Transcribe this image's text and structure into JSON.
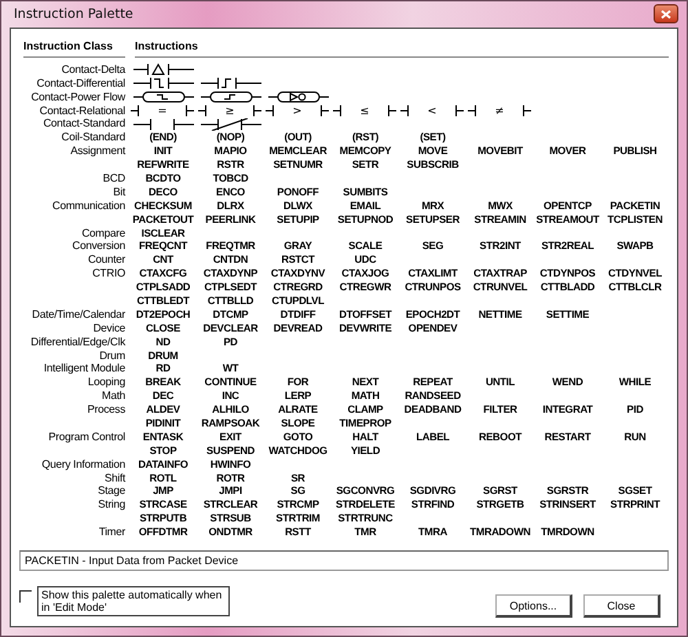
{
  "window": {
    "title": "Instruction Palette"
  },
  "headers": [
    "Instruction Class",
    "Instructions"
  ],
  "classes": [
    {
      "name": "Contact-Delta",
      "kind": "contact",
      "contacts": [
        {
          "kind": "delta"
        }
      ]
    },
    {
      "name": "Contact-Differential",
      "kind": "contact",
      "contacts": [
        {
          "kind": "falling"
        },
        {
          "kind": "rising"
        }
      ]
    },
    {
      "name": "Contact-Power Flow",
      "kind": "contact",
      "contacts": [
        {
          "kind": "pf-falling"
        },
        {
          "kind": "pf-rising"
        },
        {
          "kind": "pf-not"
        }
      ]
    },
    {
      "name": "Contact-Relational",
      "kind": "contact",
      "contacts": [
        {
          "kind": "relational",
          "symbol": "="
        },
        {
          "kind": "relational",
          "symbol": "≥"
        },
        {
          "kind": "relational",
          "symbol": ">"
        },
        {
          "kind": "relational",
          "symbol": "≤"
        },
        {
          "kind": "relational",
          "symbol": "<"
        },
        {
          "kind": "relational",
          "symbol": "≠"
        }
      ]
    },
    {
      "name": "Contact-Standard",
      "kind": "contact",
      "contacts": [
        {
          "kind": "open"
        },
        {
          "kind": "closed"
        }
      ]
    },
    {
      "name": "Coil-Standard",
      "kind": "text",
      "rows": [
        [
          "(END)",
          "(NOP)",
          "(OUT)",
          "(RST)",
          "(SET)"
        ]
      ]
    },
    {
      "name": "Assignment",
      "kind": "text",
      "rows": [
        [
          "INIT",
          "MAPIO",
          "MEMCLEAR",
          "MEMCOPY",
          "MOVE",
          "MOVEBIT",
          "MOVER",
          "PUBLISH"
        ],
        [
          "REFWRITE",
          "RSTR",
          "SETNUMR",
          "SETR",
          "SUBSCRIB"
        ]
      ]
    },
    {
      "name": "BCD",
      "kind": "text",
      "rows": [
        [
          "BCDTO",
          "TOBCD"
        ]
      ]
    },
    {
      "name": "Bit",
      "kind": "text",
      "rows": [
        [
          "DECO",
          "ENCO",
          "PONOFF",
          "SUMBITS"
        ]
      ]
    },
    {
      "name": "Communication",
      "kind": "text",
      "rows": [
        [
          "CHECKSUM",
          "DLRX",
          "DLWX",
          "EMAIL",
          "MRX",
          "MWX",
          "OPENTCP",
          "PACKETIN"
        ],
        [
          "PACKETOUT",
          "PEERLINK",
          "SETUPIP",
          "SETUPNOD",
          "SETUPSER",
          "STREAMIN",
          "STREAMOUT",
          "TCPLISTEN"
        ]
      ]
    },
    {
      "name": "Compare",
      "kind": "text",
      "rows": [
        [
          "ISCLEAR"
        ]
      ]
    },
    {
      "name": "Conversion",
      "kind": "text",
      "rows": [
        [
          "FREQCNT",
          "FREQTMR",
          "GRAY",
          "SCALE",
          "SEG",
          "STR2INT",
          "STR2REAL",
          "SWAPB"
        ]
      ]
    },
    {
      "name": "Counter",
      "kind": "text",
      "rows": [
        [
          "CNT",
          "CNTDN",
          "RSTCT",
          "UDC"
        ]
      ]
    },
    {
      "name": "CTRIO",
      "kind": "text",
      "rows": [
        [
          "CTAXCFG",
          "CTAXDYNP",
          "CTAXDYNV",
          "CTAXJOG",
          "CTAXLIMT",
          "CTAXTRAP",
          "CTDYNPOS",
          "CTDYNVEL"
        ],
        [
          "CTPLSADD",
          "CTPLSEDT",
          "CTREGRD",
          "CTREGWR",
          "CTRUNPOS",
          "CTRUNVEL",
          "CTTBLADD",
          "CTTBLCLR"
        ],
        [
          "CTTBLEDT",
          "CTTBLLD",
          "CTUPDLVL"
        ]
      ]
    },
    {
      "name": "Date/Time/Calendar",
      "kind": "text",
      "rows": [
        [
          "DT2EPOCH",
          "DTCMP",
          "DTDIFF",
          "DTOFFSET",
          "EPOCH2DT",
          "NETTIME",
          "SETTIME"
        ]
      ]
    },
    {
      "name": "Device",
      "kind": "text",
      "rows": [
        [
          "CLOSE",
          "DEVCLEAR",
          "DEVREAD",
          "DEVWRITE",
          "OPENDEV"
        ]
      ]
    },
    {
      "name": "Differential/Edge/Clk",
      "kind": "text",
      "rows": [
        [
          "ND",
          "PD"
        ]
      ]
    },
    {
      "name": "Drum",
      "kind": "text",
      "rows": [
        [
          "DRUM"
        ]
      ]
    },
    {
      "name": "Intelligent Module",
      "kind": "text",
      "rows": [
        [
          "RD",
          "WT"
        ]
      ]
    },
    {
      "name": "Looping",
      "kind": "text",
      "rows": [
        [
          "BREAK",
          "CONTINUE",
          "FOR",
          "NEXT",
          "REPEAT",
          "UNTIL",
          "WEND",
          "WHILE"
        ]
      ]
    },
    {
      "name": "Math",
      "kind": "text",
      "rows": [
        [
          "DEC",
          "INC",
          "LERP",
          "MATH",
          "RANDSEED"
        ]
      ]
    },
    {
      "name": "Process",
      "kind": "text",
      "rows": [
        [
          "ALDEV",
          "ALHILO",
          "ALRATE",
          "CLAMP",
          "DEADBAND",
          "FILTER",
          "INTEGRAT",
          "PID"
        ],
        [
          "PIDINIT",
          "RAMPSOAK",
          "SLOPE",
          "TIMEPROP"
        ]
      ]
    },
    {
      "name": "Program Control",
      "kind": "text",
      "rows": [
        [
          "ENTASK",
          "EXIT",
          "GOTO",
          "HALT",
          "LABEL",
          "REBOOT",
          "RESTART",
          "RUN"
        ],
        [
          "STOP",
          "SUSPEND",
          "WATCHDOG",
          "YIELD"
        ]
      ]
    },
    {
      "name": "Query Information",
      "kind": "text",
      "rows": [
        [
          "DATAINFO",
          "HWINFO"
        ]
      ]
    },
    {
      "name": "Shift",
      "kind": "text",
      "rows": [
        [
          "ROTL",
          "ROTR",
          "SR"
        ]
      ]
    },
    {
      "name": "Stage",
      "kind": "text",
      "rows": [
        [
          "JMP",
          "JMPI",
          "SG",
          "SGCONVRG",
          "SGDIVRG",
          "SGRST",
          "SGRSTR",
          "SGSET"
        ]
      ]
    },
    {
      "name": "String",
      "kind": "text",
      "rows": [
        [
          "STRCASE",
          "STRCLEAR",
          "STRCMP",
          "STRDELETE",
          "STRFIND",
          "STRGETB",
          "STRINSERT",
          "STRPRINT"
        ],
        [
          "STRPUTB",
          "STRSUB",
          "STRTRIM",
          "STRTRUNC"
        ]
      ]
    },
    {
      "name": "Timer",
      "kind": "text",
      "rows": [
        [
          "OFFDTMR",
          "ONDTMR",
          "RSTT",
          "TMR",
          "TMRA",
          "TMRADOWN",
          "TMRDOWN"
        ]
      ]
    }
  ],
  "description": "PACKETIN - Input Data from Packet Device",
  "auto_show": {
    "label": "Show this palette automatically when in 'Edit Mode'",
    "checked": false
  },
  "buttons": [
    "Options...",
    "Close"
  ]
}
